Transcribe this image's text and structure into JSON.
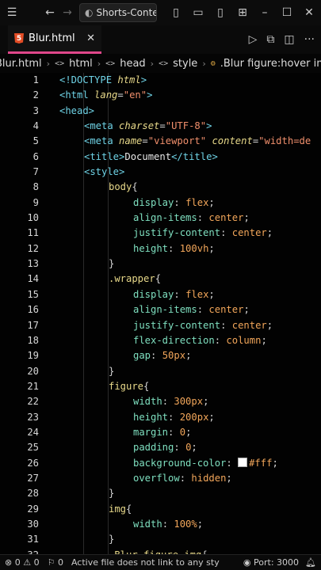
{
  "titlebar": {
    "search_text": "Shorts-Conte"
  },
  "tab": {
    "filename": "Blur.html",
    "icon_letter": "5"
  },
  "breadcrumb": [
    "Blur.html",
    "html",
    "head",
    "style",
    ".Blur figure:hover img"
  ],
  "lines": [
    {
      "n": "1",
      "indent": 0,
      "t": [
        [
          "tag",
          "<!DOCTYPE "
        ],
        [
          "attr",
          "html"
        ],
        [
          "tag",
          ">"
        ]
      ]
    },
    {
      "n": "2",
      "indent": 0,
      "t": [
        [
          "tag",
          "<html "
        ],
        [
          "attr",
          "lang"
        ],
        [
          "punc",
          "="
        ],
        [
          "str",
          "\"en\""
        ],
        [
          "tag",
          ">"
        ]
      ]
    },
    {
      "n": "3",
      "indent": 0,
      "t": [
        [
          "tag",
          "<head>"
        ]
      ]
    },
    {
      "n": "4",
      "indent": 1,
      "t": [
        [
          "tag",
          "<meta "
        ],
        [
          "attr",
          "charset"
        ],
        [
          "punc",
          "="
        ],
        [
          "str",
          "\"UTF-8\""
        ],
        [
          "tag",
          ">"
        ]
      ]
    },
    {
      "n": "5",
      "indent": 1,
      "t": [
        [
          "tag",
          "<meta "
        ],
        [
          "attr",
          "name"
        ],
        [
          "punc",
          "="
        ],
        [
          "str",
          "\"viewport\""
        ],
        [
          "punc",
          " "
        ],
        [
          "attr",
          "content"
        ],
        [
          "punc",
          "="
        ],
        [
          "str",
          "\"width=de"
        ]
      ]
    },
    {
      "n": "6",
      "indent": 1,
      "t": [
        [
          "tag",
          "<title>"
        ],
        [
          "txt",
          "Document"
        ],
        [
          "tag",
          "</title>"
        ]
      ]
    },
    {
      "n": "7",
      "indent": 1,
      "t": [
        [
          "tag",
          "<style>"
        ]
      ]
    },
    {
      "n": "8",
      "indent": 2,
      "t": [
        [
          "sel",
          "body"
        ],
        [
          "punc",
          "{"
        ]
      ]
    },
    {
      "n": "9",
      "indent": 3,
      "t": [
        [
          "prop",
          "display"
        ],
        [
          "punc",
          ": "
        ],
        [
          "val",
          "flex"
        ],
        [
          "punc",
          ";"
        ]
      ]
    },
    {
      "n": "10",
      "indent": 3,
      "t": [
        [
          "prop",
          "align-items"
        ],
        [
          "punc",
          ": "
        ],
        [
          "val",
          "center"
        ],
        [
          "punc",
          ";"
        ]
      ]
    },
    {
      "n": "11",
      "indent": 3,
      "t": [
        [
          "prop",
          "justify-content"
        ],
        [
          "punc",
          ": "
        ],
        [
          "val",
          "center"
        ],
        [
          "punc",
          ";"
        ]
      ]
    },
    {
      "n": "12",
      "indent": 3,
      "t": [
        [
          "prop",
          "height"
        ],
        [
          "punc",
          ": "
        ],
        [
          "val",
          "100vh"
        ],
        [
          "punc",
          ";"
        ]
      ]
    },
    {
      "n": "13",
      "indent": 2,
      "t": [
        [
          "punc",
          "}"
        ]
      ]
    },
    {
      "n": "14",
      "indent": 2,
      "t": [
        [
          "sel",
          ".wrapper"
        ],
        [
          "punc",
          "{"
        ]
      ]
    },
    {
      "n": "15",
      "indent": 3,
      "t": [
        [
          "prop",
          "display"
        ],
        [
          "punc",
          ": "
        ],
        [
          "val",
          "flex"
        ],
        [
          "punc",
          ";"
        ]
      ]
    },
    {
      "n": "16",
      "indent": 3,
      "t": [
        [
          "prop",
          "align-items"
        ],
        [
          "punc",
          ": "
        ],
        [
          "val",
          "center"
        ],
        [
          "punc",
          ";"
        ]
      ]
    },
    {
      "n": "17",
      "indent": 3,
      "t": [
        [
          "prop",
          "justify-content"
        ],
        [
          "punc",
          ": "
        ],
        [
          "val",
          "center"
        ],
        [
          "punc",
          ";"
        ]
      ]
    },
    {
      "n": "18",
      "indent": 3,
      "t": [
        [
          "prop",
          "flex-direction"
        ],
        [
          "punc",
          ": "
        ],
        [
          "val",
          "column"
        ],
        [
          "punc",
          ";"
        ]
      ]
    },
    {
      "n": "19",
      "indent": 3,
      "t": [
        [
          "prop",
          "gap"
        ],
        [
          "punc",
          ": "
        ],
        [
          "val",
          "50px"
        ],
        [
          "punc",
          ";"
        ]
      ]
    },
    {
      "n": "20",
      "indent": 2,
      "t": [
        [
          "punc",
          "}"
        ]
      ]
    },
    {
      "n": "21",
      "indent": 2,
      "t": [
        [
          "sel",
          "figure"
        ],
        [
          "punc",
          "{"
        ]
      ]
    },
    {
      "n": "22",
      "indent": 3,
      "t": [
        [
          "prop",
          "width"
        ],
        [
          "punc",
          ": "
        ],
        [
          "val",
          "300px"
        ],
        [
          "punc",
          ";"
        ]
      ]
    },
    {
      "n": "23",
      "indent": 3,
      "t": [
        [
          "prop",
          "height"
        ],
        [
          "punc",
          ": "
        ],
        [
          "val",
          "200px"
        ],
        [
          "punc",
          ";"
        ]
      ]
    },
    {
      "n": "24",
      "indent": 3,
      "t": [
        [
          "prop",
          "margin"
        ],
        [
          "punc",
          ": "
        ],
        [
          "val",
          "0"
        ],
        [
          "punc",
          ";"
        ]
      ]
    },
    {
      "n": "25",
      "indent": 3,
      "t": [
        [
          "prop",
          "padding"
        ],
        [
          "punc",
          ": "
        ],
        [
          "val",
          "0"
        ],
        [
          "punc",
          ";"
        ]
      ]
    },
    {
      "n": "26",
      "indent": 3,
      "t": [
        [
          "prop",
          "background-color"
        ],
        [
          "punc",
          ": "
        ],
        [
          "swatch",
          "#fff"
        ],
        [
          "val",
          "#fff"
        ],
        [
          "punc",
          ";"
        ]
      ]
    },
    {
      "n": "27",
      "indent": 3,
      "t": [
        [
          "prop",
          "overflow"
        ],
        [
          "punc",
          ": "
        ],
        [
          "val",
          "hidden"
        ],
        [
          "punc",
          ";"
        ]
      ]
    },
    {
      "n": "28",
      "indent": 2,
      "t": [
        [
          "punc",
          "}"
        ]
      ]
    },
    {
      "n": "29",
      "indent": 2,
      "t": [
        [
          "sel",
          "img"
        ],
        [
          "punc",
          "{"
        ]
      ]
    },
    {
      "n": "30",
      "indent": 3,
      "t": [
        [
          "prop",
          "width"
        ],
        [
          "punc",
          ": "
        ],
        [
          "val",
          "100%"
        ],
        [
          "punc",
          ";"
        ]
      ]
    },
    {
      "n": "31",
      "indent": 2,
      "t": [
        [
          "punc",
          "}"
        ]
      ]
    },
    {
      "n": "32",
      "indent": 2,
      "t": [
        [
          "sel",
          ".Blur figure img"
        ],
        [
          "punc",
          "{"
        ]
      ]
    }
  ],
  "status": {
    "errors": "0",
    "warnings": "0",
    "info": "0",
    "message": "Active file does not link to any sty",
    "port": "Port: 3000"
  },
  "colors": {
    "tab_accent": "#e0478a",
    "html5": "#e44d26"
  }
}
